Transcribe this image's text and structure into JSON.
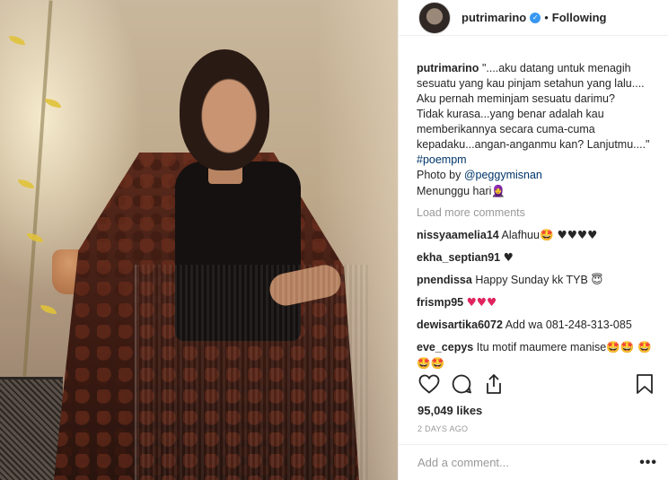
{
  "post": {
    "username": "putrimarino",
    "separator": "•",
    "follow_label": "Following",
    "verified_symbol": "✓",
    "caption_text": "\"....aku datang untuk menagih sesuatu yang kau pinjam setahun yang lalu....\nAku pernah meminjam sesuatu darimu?\nTidak kurasa...yang benar adalah kau memberikannya secara cuma-cuma kepadaku...angan-anganmu kan? Lanjutmu....\"",
    "hashtag": "#poempm",
    "photo_prefix": "Photo by",
    "photo_handle": "@peggymisnan",
    "caption_tail": "Menunggu hari",
    "caption_tail_emoji": "🧕",
    "load_more": "Load more comments"
  },
  "comments": [
    {
      "user": "nissyaamelia14",
      "text": "Alafhuu",
      "emoji": "🤩 ♥♥♥♥",
      "red": false
    },
    {
      "user": "ekha_septian91",
      "text": "",
      "emoji": "♥",
      "red": false
    },
    {
      "user": "pnendissa",
      "text": "Happy Sunday kk TYB",
      "emoji": "😇",
      "red": false
    },
    {
      "user": "frismp95",
      "text": "",
      "emoji": "♥♥♥",
      "red": true
    },
    {
      "user": "dewisartika6072",
      "text": "Add wa 081-248-313-085",
      "emoji": "",
      "red": false
    },
    {
      "user": "eve_cepys",
      "text": "Itu motif maumere manise",
      "emoji": "🤩🤩 🤩🤩🤩",
      "red": false
    }
  ],
  "stats": {
    "likes": "95,049 likes",
    "time": "2 DAYS AGO"
  },
  "composer": {
    "placeholder": "Add a comment...",
    "more": "•••"
  },
  "icons": {
    "like": "heart-icon",
    "comment": "comment-icon",
    "share": "share-icon",
    "save": "bookmark-icon"
  }
}
